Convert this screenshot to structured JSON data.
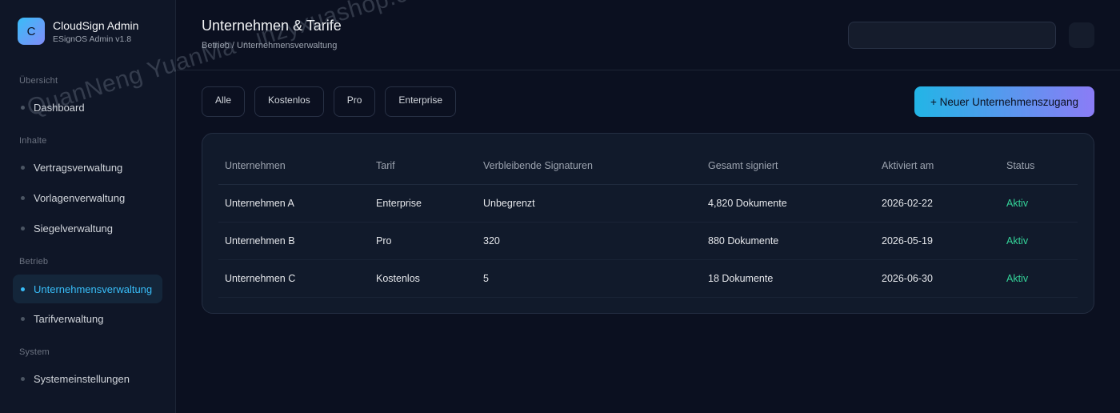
{
  "brand": {
    "logo_letter": "C",
    "title": "CloudSign Admin",
    "subtitle": "ESignOS Admin v1.8"
  },
  "sidebar": {
    "sections": [
      {
        "title": "Übersicht",
        "items": [
          {
            "label": "Dashboard"
          }
        ]
      },
      {
        "title": "Inhalte",
        "items": [
          {
            "label": "Vertragsverwaltung"
          },
          {
            "label": "Vorlagenverwaltung"
          },
          {
            "label": "Siegelverwaltung"
          }
        ]
      },
      {
        "title": "Betrieb",
        "items": [
          {
            "label": "Unternehmensverwaltung",
            "active": true
          },
          {
            "label": "Tarifverwaltung"
          }
        ]
      },
      {
        "title": "System",
        "items": [
          {
            "label": "Systemeinstellungen"
          }
        ]
      }
    ]
  },
  "header": {
    "title": "Unternehmen & Tarife",
    "breadcrumb": "Betrieb / Unternehmensverwaltung",
    "search_value": ""
  },
  "filters": [
    "Alle",
    "Kostenlos",
    "Pro",
    "Enterprise"
  ],
  "actions": {
    "new_company": "+ Neuer Unternehmenszugang"
  },
  "table": {
    "columns": [
      "Unternehmen",
      "Tarif",
      "Verbleibende Signaturen",
      "Gesamt signiert",
      "Aktiviert am",
      "Status"
    ],
    "rows": [
      [
        "Unternehmen A",
        "Enterprise",
        "Unbegrenzt",
        "4,820 Dokumente",
        "2026-02-22",
        "Aktiv"
      ],
      [
        "Unternehmen B",
        "Pro",
        "320",
        "880 Dokumente",
        "2026-05-19",
        "Aktiv"
      ],
      [
        "Unternehmen C",
        "Kostenlos",
        "5",
        "18 Dokumente",
        "2026-06-30",
        "Aktiv"
      ]
    ]
  },
  "watermark": "QuanNeng YuanMa · inzyxuashop.com",
  "colors": {
    "accent": "#38bdf8",
    "status_active": "#34d399",
    "gradient_start": "#22b5e6",
    "gradient_end": "#8b7cf6"
  }
}
